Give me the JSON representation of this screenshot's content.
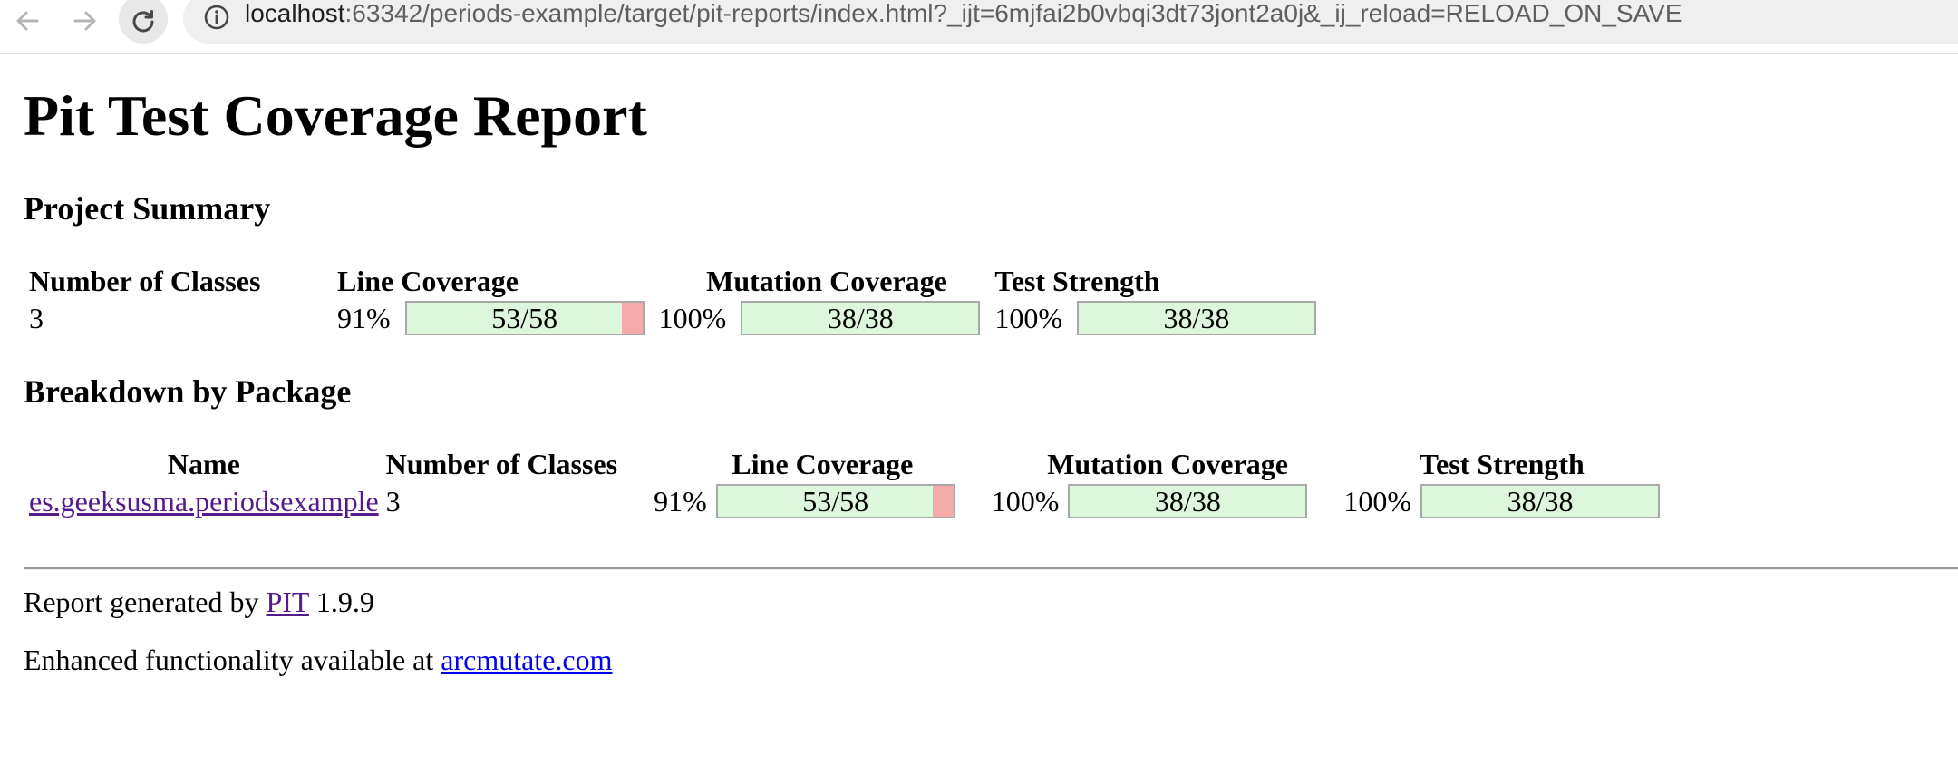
{
  "browser": {
    "url_host": "localhost",
    "url_rest": ":63342/periods-example/target/pit-reports/index.html?_ijt=6mjfai2b0vbqi3dt73jont2a0j&_ij_reload=RELOAD_ON_SAVE"
  },
  "page_title": "Pit Test Coverage Report",
  "summary": {
    "heading": "Project Summary",
    "headers": [
      "Number of Classes",
      "Line Coverage",
      "Mutation Coverage",
      "Test Strength"
    ],
    "classes": "3",
    "line": {
      "pct": "91%",
      "label": "53/58",
      "covered": 53,
      "total": 58
    },
    "mutation": {
      "pct": "100%",
      "label": "38/38",
      "covered": 38,
      "total": 38
    },
    "strength": {
      "pct": "100%",
      "label": "38/38",
      "covered": 38,
      "total": 38
    }
  },
  "breakdown": {
    "heading": "Breakdown by Package",
    "headers": [
      "Name",
      "Number of Classes",
      "Line Coverage",
      "Mutation Coverage",
      "Test Strength"
    ],
    "rows": [
      {
        "name": "es.geeksusma.periodsexample",
        "classes": "3",
        "line": {
          "pct": "91%",
          "label": "53/58",
          "covered": 53,
          "total": 58
        },
        "mutation": {
          "pct": "100%",
          "label": "38/38",
          "covered": 38,
          "total": 38
        },
        "strength": {
          "pct": "100%",
          "label": "38/38",
          "covered": 38,
          "total": 38
        }
      }
    ]
  },
  "footer": {
    "generated_prefix": "Report generated by",
    "pit_link": "PIT",
    "version": "1.9.9",
    "enhanced_prefix": "Enhanced functionality available at",
    "arcmutate_link": "arcmutate.com"
  },
  "colors": {
    "covered": "#ddf7dd",
    "uncovered": "#f4aaaa",
    "visited_link": "#551a8b",
    "link": "#0000ee"
  }
}
